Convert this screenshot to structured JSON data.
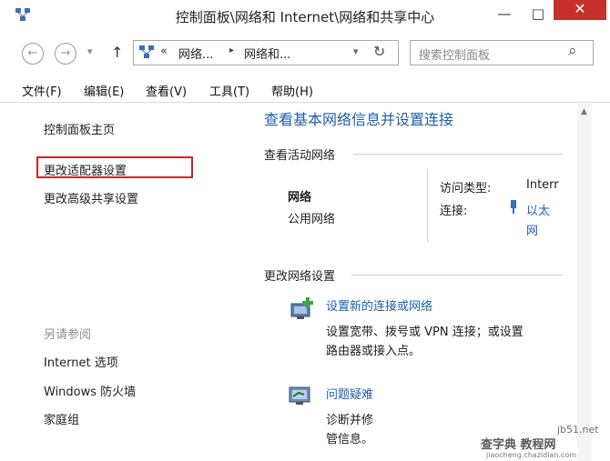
{
  "window": {
    "title": "控制面板\\网络和 Internet\\网络和共享中心",
    "minimize": "—",
    "maximize": "□",
    "close": "✕"
  },
  "nav": {
    "back": "←",
    "forward": "→",
    "dropdown": "▾",
    "up": "↑",
    "breadcrumb_prefix": "«",
    "crumb1": "网络...",
    "sep": "▸",
    "crumb2": "网络和...",
    "addr_dropdown": "▾",
    "refresh": "↻",
    "search_placeholder": "搜索控制面板",
    "search_icon": "⌕"
  },
  "menu": [
    "文件(F)",
    "编辑(E)",
    "查看(V)",
    "工具(T)",
    "帮助(H)"
  ],
  "left": {
    "home": "控制面板主页",
    "adapter": "更改适配器设置",
    "advanced": "更改高级共享设置",
    "see_also": "另请参阅",
    "internet_options": "Internet 选项",
    "firewall": "Windows 防火墙",
    "homegroup": "家庭组"
  },
  "main": {
    "heading": "查看基本网络信息并设置连接",
    "active_networks": "查看活动网络",
    "network_name": "网络",
    "network_type": "公用网络",
    "access_type_label": "访问类型:",
    "access_type_value": "Interr",
    "connection_label": "连接:",
    "connection_value_1": "以太",
    "connection_value_2": "网",
    "change_settings": "更改网络设置",
    "setup_link": "设置新的连接或网络",
    "setup_desc_1": "设置宽带、拨号或 VPN 连接；或设置",
    "setup_desc_2": "路由器或接入点。",
    "troubleshoot_link": "问题疑难",
    "troubleshoot_desc_1": "诊断并修",
    "troubleshoot_desc_2": "管信息。"
  },
  "watermark": {
    "line1": "jb51.net",
    "line2": "查字典 教程网",
    "line3": "jiaocheng.chazidian.com"
  },
  "colors": {
    "link": "#1f5fa8",
    "close": "#c7312b",
    "highlight_box": "#d0242a"
  }
}
